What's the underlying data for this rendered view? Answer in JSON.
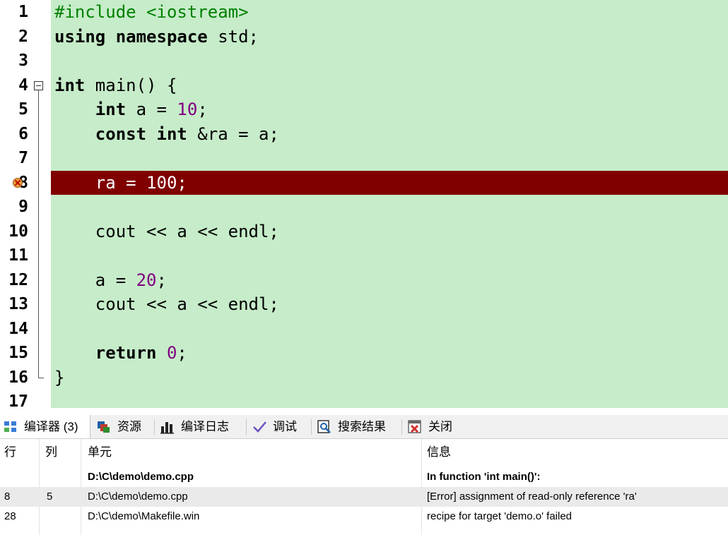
{
  "editor": {
    "line_numbers": [
      "1",
      "2",
      "3",
      "4",
      "5",
      "6",
      "7",
      "8",
      "9",
      "10",
      "11",
      "12",
      "13",
      "14",
      "15",
      "16",
      "17"
    ],
    "lines": [
      [
        {
          "t": "#include <iostream>",
          "c": "pp"
        }
      ],
      [
        {
          "t": "using namespace",
          "c": "kw"
        },
        {
          "t": " std;",
          "c": ""
        }
      ],
      [],
      [
        {
          "t": "int",
          "c": "kw"
        },
        {
          "t": " main() {",
          "c": ""
        }
      ],
      [
        {
          "t": "    ",
          "c": ""
        },
        {
          "t": "int",
          "c": "kw"
        },
        {
          "t": " a = ",
          "c": ""
        },
        {
          "t": "10",
          "c": "num"
        },
        {
          "t": ";",
          "c": ""
        }
      ],
      [
        {
          "t": "    ",
          "c": ""
        },
        {
          "t": "const int",
          "c": "kw"
        },
        {
          "t": " &ra = a;",
          "c": ""
        }
      ],
      [],
      [
        {
          "t": "    ra = 100;",
          "c": ""
        }
      ],
      [],
      [
        {
          "t": "    cout << a << endl;",
          "c": ""
        }
      ],
      [],
      [
        {
          "t": "    a = ",
          "c": ""
        },
        {
          "t": "20",
          "c": "num"
        },
        {
          "t": ";",
          "c": ""
        }
      ],
      [
        {
          "t": "    cout << a << endl;",
          "c": ""
        }
      ],
      [],
      [
        {
          "t": "    ",
          "c": ""
        },
        {
          "t": "return",
          "c": "kw"
        },
        {
          "t": " ",
          "c": ""
        },
        {
          "t": "0",
          "c": "num"
        },
        {
          "t": ";",
          "c": ""
        }
      ],
      [
        {
          "t": "}",
          "c": ""
        }
      ],
      []
    ],
    "error_line": 8,
    "colors": {
      "background": "#c6ecc9",
      "error_highlight": "#800000",
      "preprocessor": "#008000",
      "number": "#800080"
    }
  },
  "tabs": [
    {
      "label": "编译器 (3)",
      "icon": "compiler-grid-icon",
      "active": true
    },
    {
      "label": "资源",
      "icon": "resources-icon",
      "active": false
    },
    {
      "label": "编译日志",
      "icon": "compile-log-chart-icon",
      "active": false
    },
    {
      "label": "调试",
      "icon": "debug-check-icon",
      "active": false
    },
    {
      "label": "搜索结果",
      "icon": "search-results-icon",
      "active": false
    },
    {
      "label": "关闭",
      "icon": "close-panel-icon",
      "active": false
    }
  ],
  "messages": {
    "headers": {
      "line": "行",
      "col": "列",
      "unit": "单元",
      "info": "信息"
    },
    "rows": [
      {
        "line": "",
        "col": "",
        "unit": "D:\\C\\demo\\demo.cpp",
        "info": "In function 'int main()':",
        "bold": true
      },
      {
        "line": "8",
        "col": "5",
        "unit": "D:\\C\\demo\\demo.cpp",
        "info": "[Error] assignment of read-only reference 'ra'",
        "bold": false,
        "selected": true
      },
      {
        "line": "28",
        "col": "",
        "unit": "D:\\C\\demo\\Makefile.win",
        "info": "recipe for target 'demo.o' failed",
        "bold": false
      }
    ]
  }
}
